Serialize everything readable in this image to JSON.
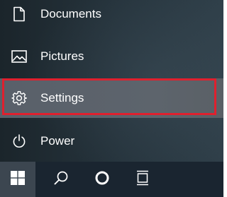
{
  "menu": {
    "items": [
      {
        "id": "documents",
        "label": "Documents",
        "icon": "document-icon"
      },
      {
        "id": "pictures",
        "label": "Pictures",
        "icon": "pictures-icon"
      },
      {
        "id": "settings",
        "label": "Settings",
        "icon": "gear-icon",
        "highlighted": true
      },
      {
        "id": "power",
        "label": "Power",
        "icon": "power-icon"
      }
    ]
  },
  "taskbar": {
    "buttons": [
      {
        "id": "start",
        "icon": "windows-logo-icon"
      },
      {
        "id": "search",
        "icon": "search-icon"
      },
      {
        "id": "cortana",
        "icon": "cortana-circle-icon"
      },
      {
        "id": "task-view",
        "icon": "task-view-icon"
      }
    ]
  },
  "colors": {
    "highlight_border": "#e0202e",
    "hover_background": "#5d646c",
    "taskbar": "#1a2530",
    "start_button": "#3c4650"
  }
}
